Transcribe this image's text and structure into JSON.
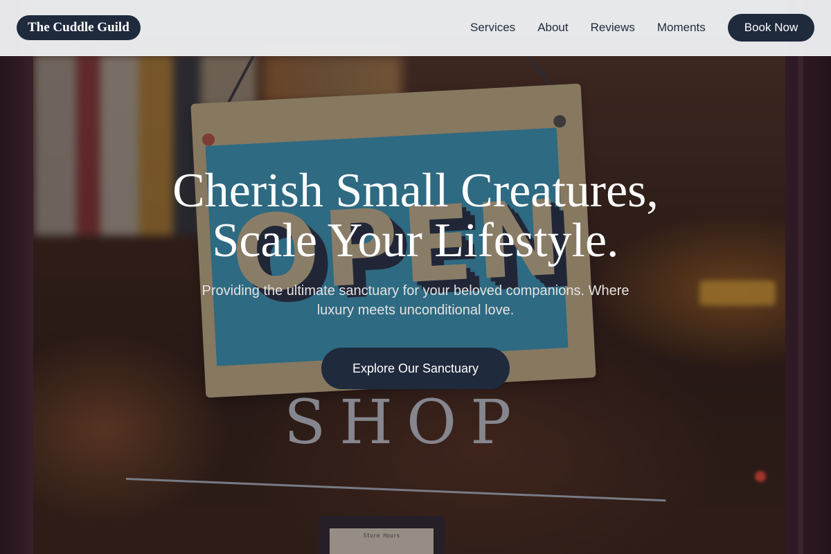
{
  "brand": {
    "name": "The Cuddle Guild"
  },
  "nav": {
    "links": [
      "Services",
      "About",
      "Reviews",
      "Moments"
    ],
    "cta_label": "Book Now"
  },
  "hero": {
    "title_line1": "Cherish Small Creatures,",
    "title_line2": "Scale Your Lifestyle.",
    "subtitle": "Providing the ultimate sanctuary for your beloved companions. Where luxury meets unconditional love.",
    "cta_label": "Explore Our Sanctuary",
    "background": {
      "sign_text": "OPEN",
      "glass_text": "SHOP",
      "hours_text": "Store Hours"
    }
  },
  "colors": {
    "primary_dark": "#1f2a3d",
    "nav_background": "#f4f6f9",
    "nav_text": "#1e293b",
    "hero_text": "#ffffff"
  }
}
